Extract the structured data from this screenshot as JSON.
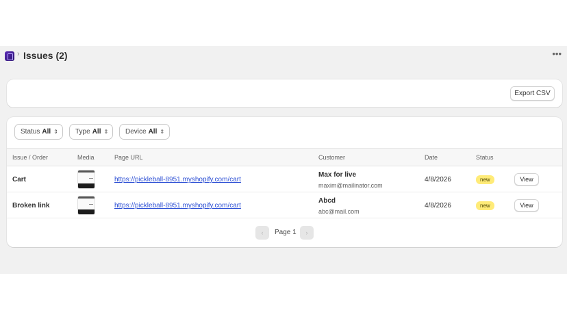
{
  "header": {
    "title": "Issues (2)",
    "breadcrumb_separator": "›",
    "more_icon": "more-horizontal-icon",
    "app_icon": "app-logo-icon"
  },
  "toolbar": {
    "export_label": "Export CSV"
  },
  "filters": [
    {
      "label": "Status",
      "value": "All"
    },
    {
      "label": "Type",
      "value": "All"
    },
    {
      "label": "Device",
      "value": "All"
    }
  ],
  "table": {
    "columns": [
      "Issue / Order",
      "Media",
      "Page URL",
      "Customer",
      "Date",
      "Status"
    ],
    "rows": [
      {
        "issue": "Cart",
        "url": "https://pickleball-8951.myshopify.com/cart",
        "customer_name": "Max for live",
        "customer_email": "maxim@mailinator.com",
        "date": "4/8/2026",
        "status": "new",
        "action": "View"
      },
      {
        "issue": "Broken link",
        "url": "https://pickleball-8951.myshopify.com/cart",
        "customer_name": "Abcd",
        "customer_email": "abc@mail.com",
        "date": "4/8/2026",
        "status": "new",
        "action": "View"
      }
    ]
  },
  "pagination": {
    "label": "Page 1",
    "prev": "‹",
    "next": "›"
  },
  "colors": {
    "link": "#2c4fd4",
    "badge_new": "#ffeb78",
    "app_bg": "#f1f1f1"
  }
}
